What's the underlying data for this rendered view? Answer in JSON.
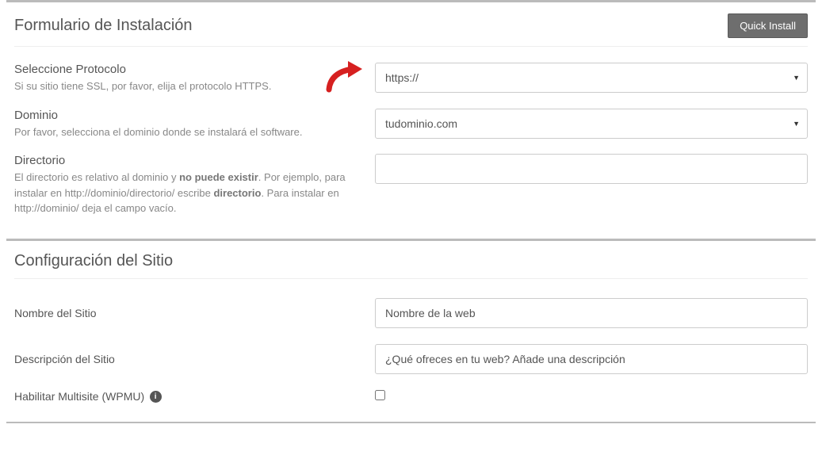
{
  "install_form": {
    "title": "Formulario de Instalación",
    "quick_install_label": "Quick Install",
    "protocol": {
      "label": "Seleccione Protocolo",
      "help": "Si su sitio tiene SSL, por favor, elija el protocolo HTTPS.",
      "value": "https://"
    },
    "domain": {
      "label": "Dominio",
      "help": "Por favor, selecciona el dominio donde se instalará el software.",
      "value": "tudominio.com"
    },
    "directory": {
      "label": "Directorio",
      "help_pre": "El directorio es relativo al dominio y ",
      "help_bold1": "no puede existir",
      "help_mid": ". Por ejemplo, para instalar en http://dominio/directorio/ escribe ",
      "help_bold2": "directorio",
      "help_post": ". Para instalar en http://dominio/ deja el campo vacío.",
      "value": ""
    }
  },
  "site_config": {
    "title": "Configuración del Sitio",
    "site_name": {
      "label": "Nombre del Sitio",
      "value": "Nombre de la web"
    },
    "site_desc": {
      "label": "Descripción del Sitio",
      "value": "¿Qué ofreces en tu web? Añade una descripción"
    },
    "multisite": {
      "label": "Habilitar Multisite (WPMU)",
      "checked": false
    }
  }
}
